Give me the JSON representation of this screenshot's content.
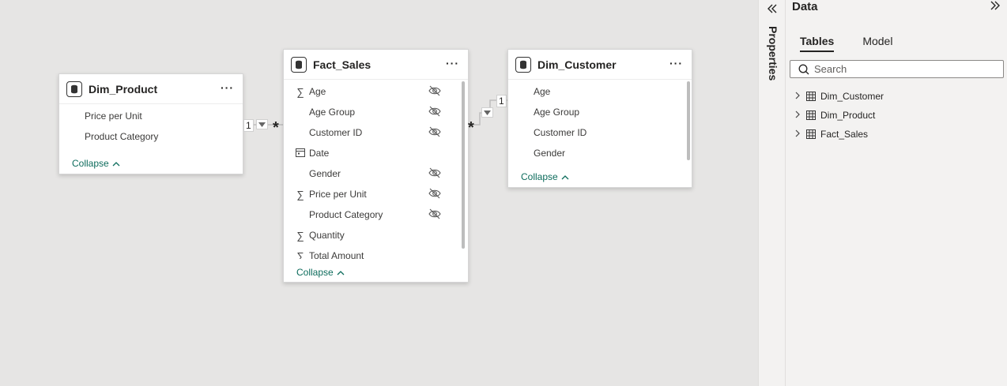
{
  "tables": {
    "dim_product": {
      "title": "Dim_Product",
      "fields": [
        "Price per Unit",
        "Product Category"
      ],
      "collapse": "Collapse"
    },
    "fact_sales": {
      "title": "Fact_Sales",
      "fields": [
        {
          "label": "Age",
          "icon": "sigma-icon",
          "hidden": true
        },
        {
          "label": "Age Group",
          "icon": "none",
          "hidden": true
        },
        {
          "label": "Customer ID",
          "icon": "none",
          "hidden": true
        },
        {
          "label": "Date",
          "icon": "calendar-icon",
          "hidden": false
        },
        {
          "label": "Gender",
          "icon": "none",
          "hidden": true
        },
        {
          "label": "Price per Unit",
          "icon": "sigma-icon",
          "hidden": true
        },
        {
          "label": "Product Category",
          "icon": "none",
          "hidden": true
        },
        {
          "label": "Quantity",
          "icon": "sigma-icon",
          "hidden": false
        },
        {
          "label": "Total Amount",
          "icon": "sigma-icon",
          "hidden": false
        }
      ],
      "collapse": "Collapse"
    },
    "dim_customer": {
      "title": "Dim_Customer",
      "fields": [
        "Age",
        "Age Group",
        "Customer ID",
        "Gender"
      ],
      "collapse": "Collapse"
    }
  },
  "relationships": {
    "product_sales": {
      "one": "1",
      "many": "*"
    },
    "sales_customer": {
      "one": "1",
      "many": "*"
    }
  },
  "properties_pane": {
    "label": "Properties"
  },
  "data_pane": {
    "title": "Data",
    "tabs": [
      "Tables",
      "Model"
    ],
    "active_tab": "Tables",
    "search_placeholder": "Search",
    "tree": [
      "Dim_Customer",
      "Dim_Product",
      "Fact_Sales"
    ]
  },
  "colors": {
    "accent": "#0d6c5c",
    "canvas": "#e6e5e4",
    "pane": "#f3f2f1"
  }
}
